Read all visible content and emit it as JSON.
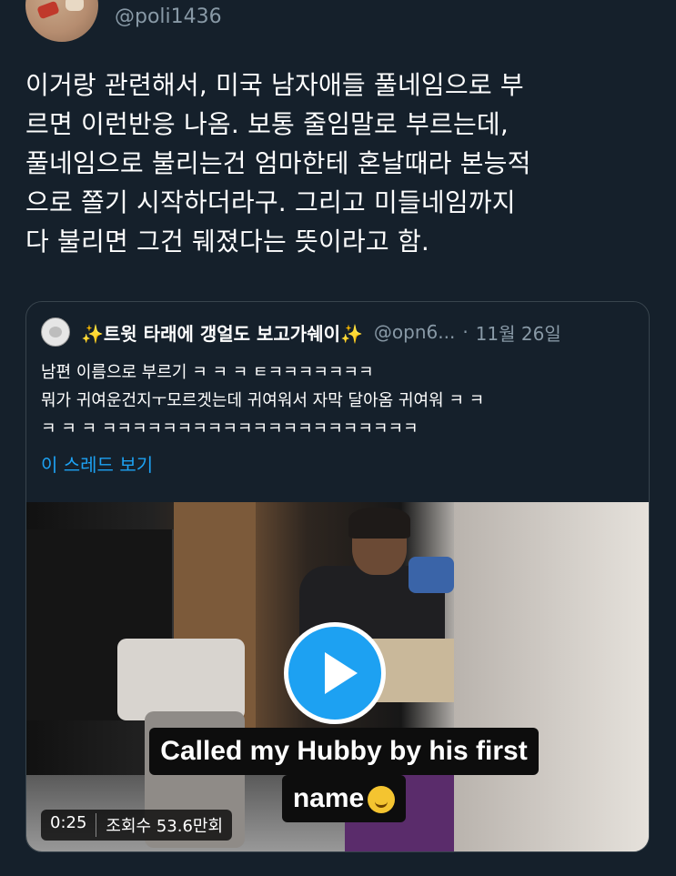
{
  "author": {
    "handle": "@poli1436"
  },
  "tweet": {
    "lines": [
      "이거랑 관련해서, 미국 남자애들 풀네임으로 부",
      "르면 이런반응 나옴. 보통 줄임말로 부르는데,",
      "풀네임으로 불리는건 엄마한테 혼날때라 본능적",
      "으로 쫄기 시작하더라구. 그리고 미들네임까지",
      "다 불리면 그건 뒈졌다는 뜻이라고 함."
    ]
  },
  "quote": {
    "spark_left": "✨",
    "name": "트윗 타래에 갱얼도 보고가쉐이",
    "spark_right": "✨",
    "handle": "@opn6...",
    "dot": "·",
    "date": "11월 26일",
    "text_lines": [
      "남편 이름으로 부르기 ㅋ ㅋ ㅋ ㅌㅋㅋㅋㅋㅋㅋㅋ",
      "뭐가 귀여운건지ㅜ모르겟는데 귀여워서 자막 달아옴 귀여워 ㅋ ㅋ",
      "ㅋ ㅋ ㅋ ㅋㅋㅋㅋㅋㅋㅋㅋㅋㅋㅋㅋㅋㅋㅋㅋㅋㅋㅋㅋㅋ"
    ],
    "thread_link": "이 스레드 보기"
  },
  "video": {
    "caption_line1": "Called my Hubby by his first",
    "caption_line2": "name",
    "duration": "0:25",
    "views": "조회수 53.6만회",
    "play_icon": "play-icon"
  },
  "colors": {
    "background": "#15202b",
    "accent": "#1da1f2",
    "secondary_text": "#8899a6",
    "border": "#38444d"
  }
}
